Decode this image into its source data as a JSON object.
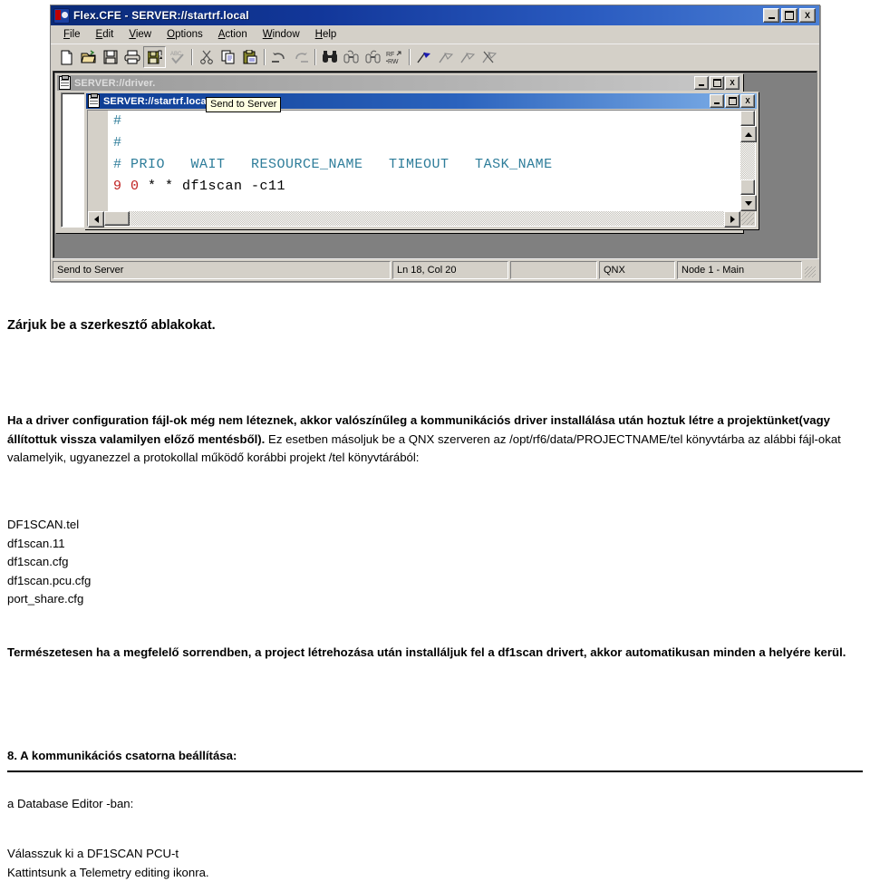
{
  "app": {
    "title": "Flex.CFE - SERVER://startrf.local",
    "icon": "cfe-logo-icon",
    "window_buttons": [
      {
        "name": "minimize",
        "glyph": "_"
      },
      {
        "name": "maximize",
        "glyph": "□"
      },
      {
        "name": "close",
        "glyph": "X"
      }
    ],
    "menu": [
      {
        "label": "File"
      },
      {
        "label": "Edit"
      },
      {
        "label": "View"
      },
      {
        "label": "Options"
      },
      {
        "label": "Action"
      },
      {
        "label": "Window"
      },
      {
        "label": "Help"
      }
    ],
    "toolbar": [
      {
        "name": "new-file-icon",
        "title": "New"
      },
      {
        "name": "open-folder-icon",
        "title": "Open"
      },
      {
        "name": "save-icon",
        "title": "Save"
      },
      {
        "name": "print-icon",
        "title": "Print"
      },
      {
        "name": "send-to-server-icon",
        "title": "Send to Server",
        "pressed": true
      },
      {
        "name": "spellcheck-icon",
        "title": "Spelling"
      },
      {
        "name": "cut-icon",
        "title": "Cut"
      },
      {
        "name": "copy-icon",
        "title": "Copy"
      },
      {
        "name": "paste-icon",
        "title": "Paste"
      },
      {
        "name": "undo-icon",
        "title": "Undo"
      },
      {
        "name": "redo-icon",
        "title": "Redo"
      },
      {
        "name": "find-binoculars-icon",
        "title": "Find"
      },
      {
        "name": "find-next-icon",
        "title": "Find Next"
      },
      {
        "name": "find-previous-icon",
        "title": "Find Previous"
      },
      {
        "name": "rf-raw-icon",
        "title": "RF RAW"
      },
      {
        "name": "flag-icon",
        "title": "Flag"
      },
      {
        "name": "tag-1-icon",
        "title": "Tag"
      },
      {
        "name": "tag-2-icon",
        "title": "Tag"
      },
      {
        "name": "tag-clear-icon",
        "title": "Clear tags"
      }
    ]
  },
  "child_back": {
    "title": "SERVER://driver.",
    "icon": "document-icon"
  },
  "child_front": {
    "title": "SERVER://startrf.local",
    "icon": "document-icon",
    "lines": [
      [
        {
          "t": "#",
          "c": "hash"
        }
      ],
      [
        {
          "t": "#",
          "c": "hash"
        }
      ],
      [
        {
          "t": "# PRIO   WAIT   RESOURCE_NAME   TIMEOUT   TASK_NAME",
          "c": "cmt"
        }
      ],
      [
        {
          "t": "9 0",
          "c": "red"
        },
        {
          "t": " * * df1scan -c11",
          "c": "blk"
        }
      ]
    ]
  },
  "tooltip": {
    "text": "Send to Server"
  },
  "statusbar": {
    "hint": "Send to Server",
    "position": "Ln 18, Col 20",
    "blank": "",
    "platform": "QNX",
    "node": "Node 1 - Main"
  },
  "document": {
    "close_note": "Zárjuk be a szerkesztő ablakokat.",
    "main_bold_1": "Ha a driver configuration fájl-ok még nem léteznek, akkor valószínűleg a kommunikációs driver installálása után hoztuk létre a projektünket(vagy állítottuk vissza valamilyen előző mentésből).",
    "main_rest": " Ez esetben másoljuk be a QNX szerveren az /opt/rf6/data/PROJECTNAME/tel könyvtárba az alábbi fájl-okat valamelyik, ugyanezzel a protokollal működő korábbi projekt  /tel könyvtárából:",
    "files": [
      "DF1SCAN.tel",
      "df1scan.11",
      "df1scan.cfg",
      "df1scan.pcu.cfg",
      "port_share.cfg"
    ],
    "terms_note": "Természetesen ha a megfelelő sorrendben, a project létrehozása után installáljuk fel a df1scan drivert, akkor automatikusan minden a helyére kerül.",
    "section_heading": "8. A kommunikációs csatorna beállítása:",
    "dbe_line": "a Database Editor -ban:",
    "tail_line_1": "Válasszuk ki a DF1SCAN PCU-t",
    "tail_line_2": "Kattintsunk a Telemetry editing ikonra."
  },
  "colors": {
    "titlebar_start": "#0a2a77",
    "titlebar_end": "#4b7fd4",
    "face": "#d4d0c8",
    "comment": "#2e7d9a",
    "number_red": "#c02020",
    "tooltip_bg": "#ffffe1"
  }
}
